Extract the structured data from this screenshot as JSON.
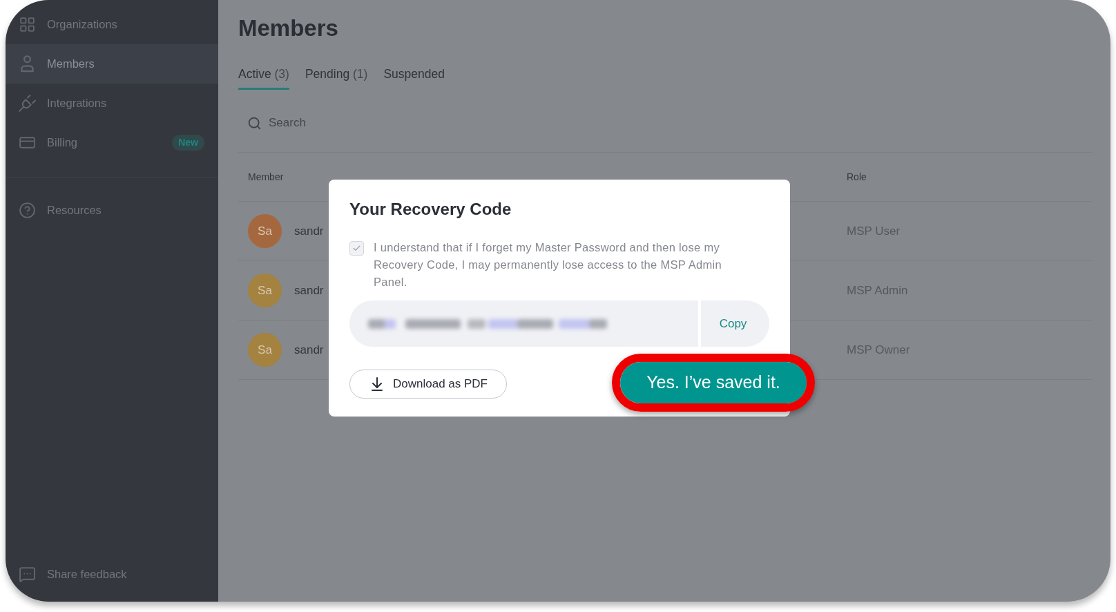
{
  "sidebar": {
    "items": [
      {
        "label": "Organizations",
        "selected": false
      },
      {
        "label": "Members",
        "selected": true
      },
      {
        "label": "Integrations",
        "selected": false
      },
      {
        "label": "Billing",
        "selected": false,
        "badge": "New"
      }
    ],
    "secondary_items": [
      {
        "label": "Resources"
      }
    ],
    "footer_item": {
      "label": "Share feedback"
    }
  },
  "main": {
    "title": "Members",
    "tabs": [
      {
        "label": "Active",
        "count": "(3)",
        "selected": true
      },
      {
        "label": "Pending",
        "count": "(1)",
        "selected": false
      },
      {
        "label": "Suspended",
        "selected": false
      }
    ],
    "search": {
      "placeholder": "Search"
    },
    "table": {
      "columns": [
        "Member",
        "Role"
      ],
      "rows": [
        {
          "avatar": "Sa",
          "color": "#a5683e",
          "name": "sandr",
          "role": "MSP User"
        },
        {
          "avatar": "Sa",
          "color": "#a4823f",
          "name": "sandr",
          "role": "MSP Admin"
        },
        {
          "avatar": "Sa",
          "color": "#a4823f",
          "name": "sandr",
          "role": "MSP Owner"
        }
      ]
    }
  },
  "dialog": {
    "title": "Your Recovery Code",
    "acknowledgement": {
      "text": "I understand that if I forget my Master Password and then lose my Recovery Code, I may permanently lose access to the MSP Admin Panel.",
      "checked": true,
      "disabled": true
    },
    "copy_button": "Copy",
    "download_button": "Download as PDF",
    "confirm_button": {
      "label": "Yes. I’ve saved it.",
      "highlighted": true
    }
  }
}
